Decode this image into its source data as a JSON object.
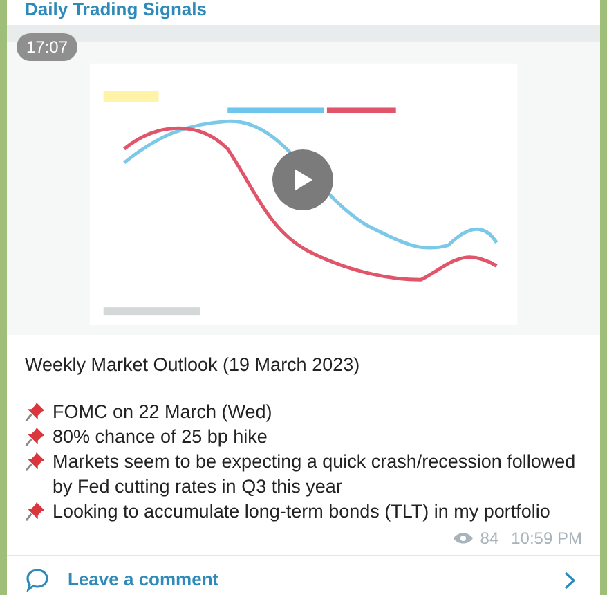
{
  "channel": {
    "title": "Daily Trading Signals"
  },
  "video": {
    "kind": "picture",
    "duration": "17:07"
  },
  "message": {
    "heading": "Weekly Market Outlook (19 March 2023)",
    "bullets": [
      {
        "text": "FOMC on 22 March (Wed)"
      },
      {
        "text": "80% chance of 25 bp hike"
      },
      {
        "text": "Markets seem to be expecting a quick crash/recession followed by Fed cutting rates in Q3 this year"
      },
      {
        "text": "Looking to accumulate long-term bonds (TLT) in my portfolio"
      }
    ],
    "views": "84",
    "time": "10:59 PM"
  },
  "footer": {
    "comment_link": "Leave a comment"
  }
}
